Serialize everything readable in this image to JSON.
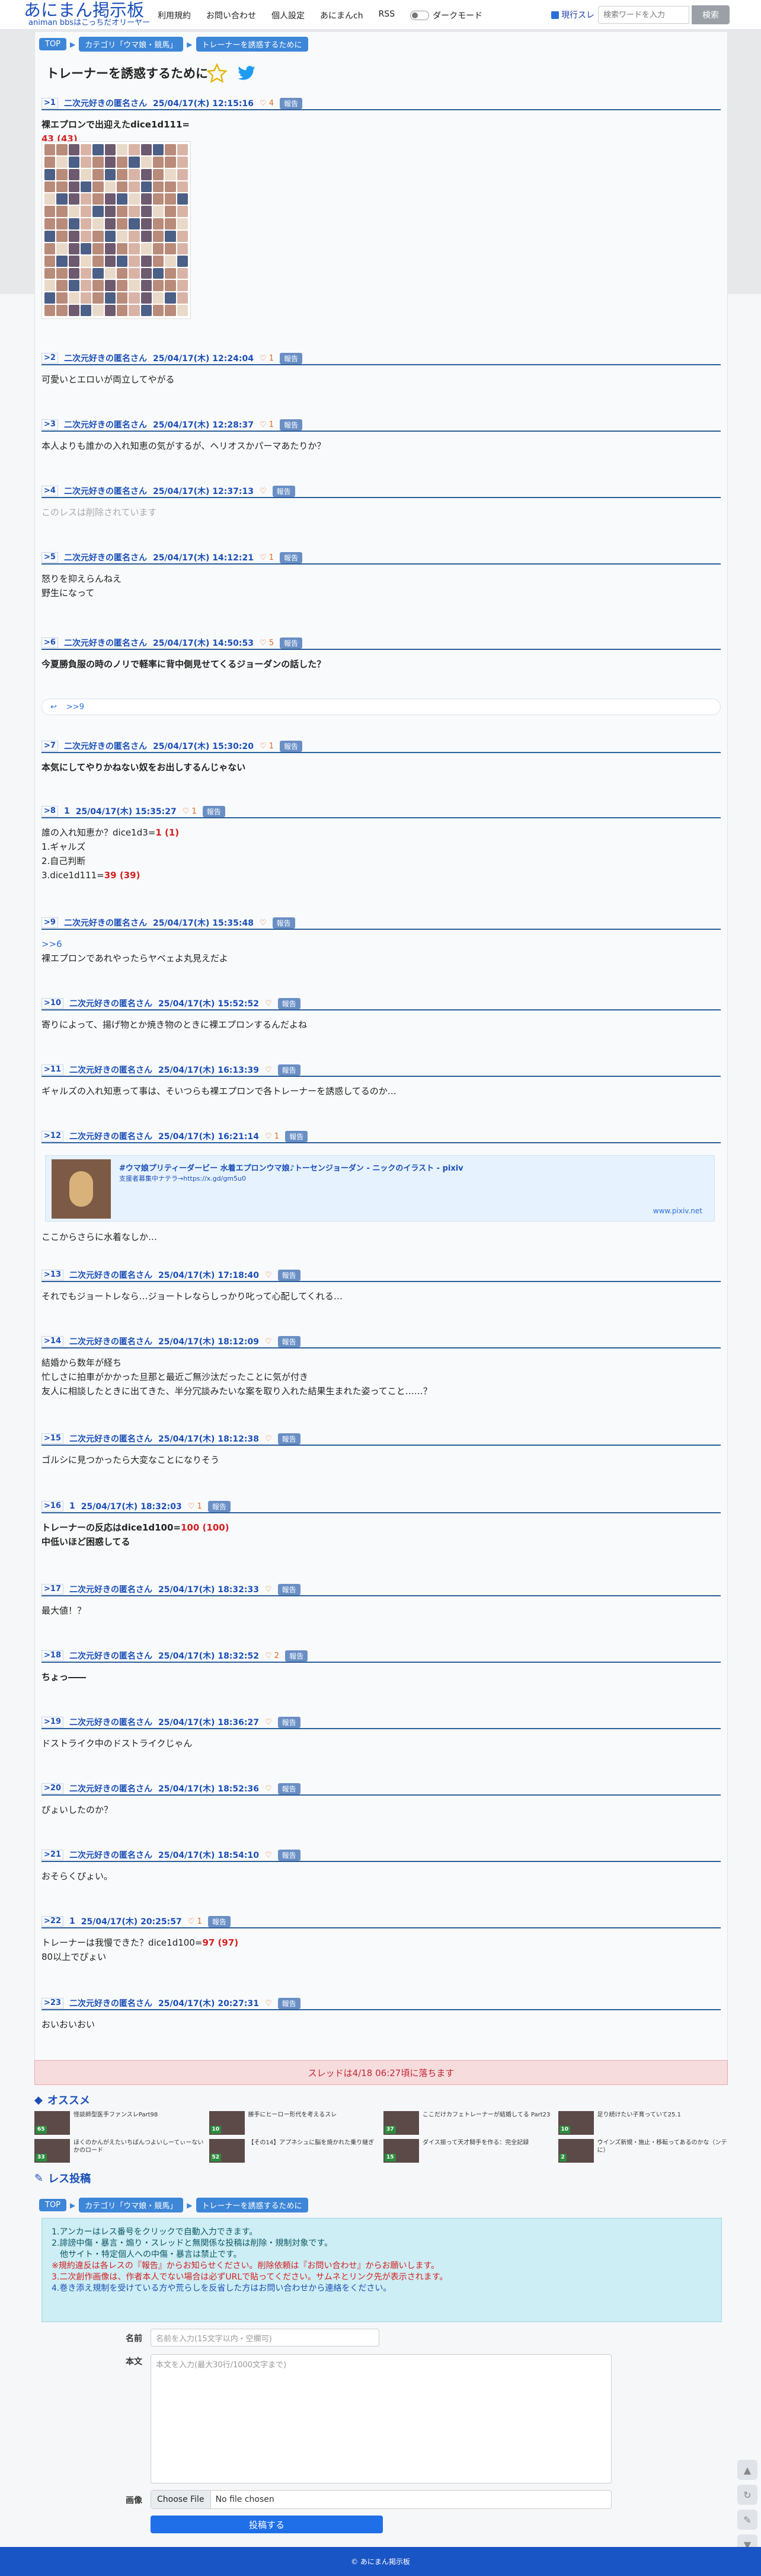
{
  "site": {
    "title": "あにまん掲示板",
    "subtitle": "animan bbsはこっちだオリーヤー"
  },
  "nav": [
    {
      "label": "利用規約"
    },
    {
      "label": "お問い合わせ"
    },
    {
      "label": "個人設定"
    },
    {
      "label": "あにまんch"
    },
    {
      "label": "RSS"
    }
  ],
  "dark_mode_label": "ダークモード",
  "search": {
    "checkbox_label": "現行スレ",
    "placeholder": "検索ワードを入力",
    "button": "検索"
  },
  "breadcrumb": [
    "TOP",
    "カテゴリ「ウマ娘・競馬」",
    "トレーナーを誘惑するために"
  ],
  "thread_title": "トレーナーを誘惑するために",
  "report_label": "報告",
  "posts": [
    {
      "no": ">1",
      "name": "二次元好きの匿名さん",
      "date": "25/04/17(木) 12:15:16",
      "hearts": "4",
      "body": [
        {
          "text": "裸エプロンで出迎えたdice1d111=",
          "bold": true
        },
        {
          "text": "43 (43)",
          "red": true
        }
      ]
    },
    {
      "no": ">2",
      "name": "二次元好きの匿名さん",
      "date": "25/04/17(木) 12:24:04",
      "hearts": "1",
      "body": [
        {
          "text": "可愛いとエロいが両立してやがる"
        }
      ]
    },
    {
      "no": ">3",
      "name": "二次元好きの匿名さん",
      "date": "25/04/17(木) 12:28:37",
      "hearts": "1",
      "body": [
        {
          "text": "本人よりも誰かの入れ知恵の気がするが、ヘリオスかパーマあたりか？"
        }
      ]
    },
    {
      "no": ">4",
      "name": "二次元好きの匿名さん",
      "date": "25/04/17(木) 12:37:13",
      "hearts": "",
      "body": [
        {
          "text": "このレスは削除されています",
          "gray": true
        }
      ]
    },
    {
      "no": ">5",
      "name": "二次元好きの匿名さん",
      "date": "25/04/17(木) 14:12:21",
      "hearts": "1",
      "body": [
        {
          "text": "怒りを抑えらんねえ"
        },
        {
          "text": "野生になって"
        }
      ]
    },
    {
      "no": ">6",
      "name": "二次元好きの匿名さん",
      "date": "25/04/17(木) 14:50:53",
      "hearts": "5",
      "body": [
        {
          "text": "今夏勝負服の時のノリで軽率に背中側見せてくるジョーダンの話した？",
          "bold": true
        }
      ],
      "quote": ">>9"
    },
    {
      "no": ">7",
      "name": "二次元好きの匿名さん",
      "date": "25/04/17(木) 15:30:20",
      "hearts": "1",
      "body": [
        {
          "text": "本気にしてやりかねない奴をお出しするんじゃない",
          "bold": true
        }
      ]
    },
    {
      "no": ">8",
      "name": "1",
      "date": "25/04/17(木) 15:35:27",
      "hearts": "1",
      "body": [
        {
          "text": "誰の入れ知恵か？dice1d3=",
          "red_suffix": "1 (1)"
        },
        {
          "text": "1.ギャルズ"
        },
        {
          "text": "2.自己判断"
        },
        {
          "text": "3.dice1d111=",
          "red_suffix": "39 (39)"
        }
      ]
    },
    {
      "no": ">9",
      "name": "二次元好きの匿名さん",
      "date": "25/04/17(木) 15:35:48",
      "hearts": "",
      "body": [
        {
          "text": ">>6",
          "link": true
        },
        {
          "text": "裸エプロンであれやったらヤベェよ丸見えだよ"
        }
      ]
    },
    {
      "no": ">10",
      "name": "二次元好きの匿名さん",
      "date": "25/04/17(木) 15:52:52",
      "hearts": "",
      "body": [
        {
          "text": "寄りによって、揚げ物とか焼き物のときに裸エプロンするんだよね"
        }
      ]
    },
    {
      "no": ">11",
      "name": "二次元好きの匿名さん",
      "date": "25/04/17(木) 16:13:39",
      "hearts": "",
      "body": [
        {
          "text": "ギャルズの入れ知恵って事は、そいつらも裸エプロンで各トレーナーを誘惑してるのか…"
        }
      ]
    },
    {
      "no": ">12",
      "name": "二次元好きの匿名さん",
      "date": "25/04/17(木) 16:21:14",
      "hearts": "1",
      "body": [
        {
          "text": "ここからさらに水着なしか…"
        }
      ]
    },
    {
      "no": ">13",
      "name": "二次元好きの匿名さん",
      "date": "25/04/17(木) 17:18:40",
      "hearts": "",
      "body": [
        {
          "text": "それでもジョートレなら…ジョートレならしっかり叱って心配してくれる…"
        }
      ]
    },
    {
      "no": ">14",
      "name": "二次元好きの匿名さん",
      "date": "25/04/17(木) 18:12:09",
      "hearts": "",
      "body": [
        {
          "text": "結婚から数年が経ち"
        },
        {
          "text": "忙しさに拍車がかかった旦那と最近ご無沙汰だったことに気が付き"
        },
        {
          "text": "友人に相談したときに出てきた、半分冗談みたいな案を取り入れた結果生まれた姿ってこと……？"
        }
      ]
    },
    {
      "no": ">15",
      "name": "二次元好きの匿名さん",
      "date": "25/04/17(木) 18:12:38",
      "hearts": "",
      "body": [
        {
          "text": "ゴルシに見つかったら大変なことになりそう"
        }
      ]
    },
    {
      "no": ">16",
      "name": "1",
      "date": "25/04/17(木) 18:32:03",
      "hearts": "1",
      "body": [
        {
          "text": "トレーナーの反応はdice1d100=",
          "bold": true,
          "red_suffix": "100 (100)"
        },
        {
          "text": "中低いほど困惑してる",
          "bold": true
        }
      ]
    },
    {
      "no": ">17",
      "name": "二次元好きの匿名さん",
      "date": "25/04/17(木) 18:32:33",
      "hearts": "",
      "body": [
        {
          "text": "最大値！？"
        }
      ]
    },
    {
      "no": ">18",
      "name": "二次元好きの匿名さん",
      "date": "25/04/17(木) 18:32:52",
      "hearts": "2",
      "body": [
        {
          "text": "ちょっ――",
          "bold": true
        }
      ]
    },
    {
      "no": ">19",
      "name": "二次元好きの匿名さん",
      "date": "25/04/17(木) 18:36:27",
      "hearts": "",
      "body": [
        {
          "text": "ドストライク中のドストライクじゃん"
        }
      ]
    },
    {
      "no": ">20",
      "name": "二次元好きの匿名さん",
      "date": "25/04/17(木) 18:52:36",
      "hearts": "",
      "body": [
        {
          "text": "ぴょいしたのか？"
        }
      ]
    },
    {
      "no": ">21",
      "name": "二次元好きの匿名さん",
      "date": "25/04/17(木) 18:54:10",
      "hearts": "",
      "body": [
        {
          "text": "おそらくぴょい。"
        }
      ]
    },
    {
      "no": ">22",
      "name": "1",
      "date": "25/04/17(木) 20:25:57",
      "hearts": "1",
      "body": [
        {
          "text": "トレーナーは我慢できた？dice1d100=",
          "red_suffix": "97 (97)"
        },
        {
          "text": "80以上でぴょい"
        }
      ]
    },
    {
      "no": ">23",
      "name": "二次元好きの匿名さん",
      "date": "25/04/17(木) 20:27:31",
      "hearts": "",
      "body": [
        {
          "text": "おいおいおい"
        }
      ]
    }
  ],
  "pixiv": {
    "title": "#ウマ娘プリティーダービー 水着エプロンウマ娘♪トーセンジョーダン - ニックのイラスト - pixiv",
    "desc": "支援者募集中ナテラ→https://x.gd/gm5u0",
    "url": "www.pixiv.net"
  },
  "closing": "スレッドは4/18 06:27頃に落ちます",
  "recommend": {
    "heading": "オススメ",
    "items": [
      {
        "title": "怪談師型医手ファンスレPart98",
        "badge": "65"
      },
      {
        "title": "勝手にヒーロー形代を考えるスレ",
        "badge": "10"
      },
      {
        "title": "ここだけカフェトレーナーが結婚してる Part23",
        "badge": "37"
      },
      {
        "title": "足り続けたい子育っていて25.1",
        "badge": "10"
      },
      {
        "title": "ほくのかんがえたいちばんつよいしーてぃーないかのロード",
        "badge": "33"
      },
      {
        "title": "【その14】アプネシュに脳を焼かれた乗り継ぎ",
        "badge": "52"
      },
      {
        "title": "ダイス振って天才騎手を作る：完全記録",
        "badge": "15"
      },
      {
        "title": "ウインズ新規・施止・移転ってあるのかな（ンテに）",
        "badge": "2"
      }
    ]
  },
  "form": {
    "heading": "レス投稿",
    "rules": [
      "1.アンカーはレス番号をクリックで自動入力できます。",
      "2.誹謗中傷・暴言・煽り・スレッドと無関係な投稿は削除・規制対象です。",
      "他サイト・特定個人への中傷・暴言は禁止です。",
      "※規約違反は各レスの『報告』からお知らせください。削除依頼は『お問い合わせ』からお願いします。",
      "3.二次創作画像は、作者本人でない場合は必ずURLで貼ってください。サムネとリンク先が表示されます。",
      "4.巻き添え規制を受けている方や荒らしを反省した方はお問い合わせから連絡をください。"
    ],
    "name_label": "名前",
    "name_placeholder": "名前を入力(15文字以内・空欄可)",
    "body_label": "本文",
    "body_placeholder": "本文を入力(最大30行/1000文字まで)",
    "image_label": "画像",
    "file_button": "Choose File",
    "file_status": "No file chosen",
    "submit": "投稿する"
  },
  "footer": "© あにまん掲示板"
}
